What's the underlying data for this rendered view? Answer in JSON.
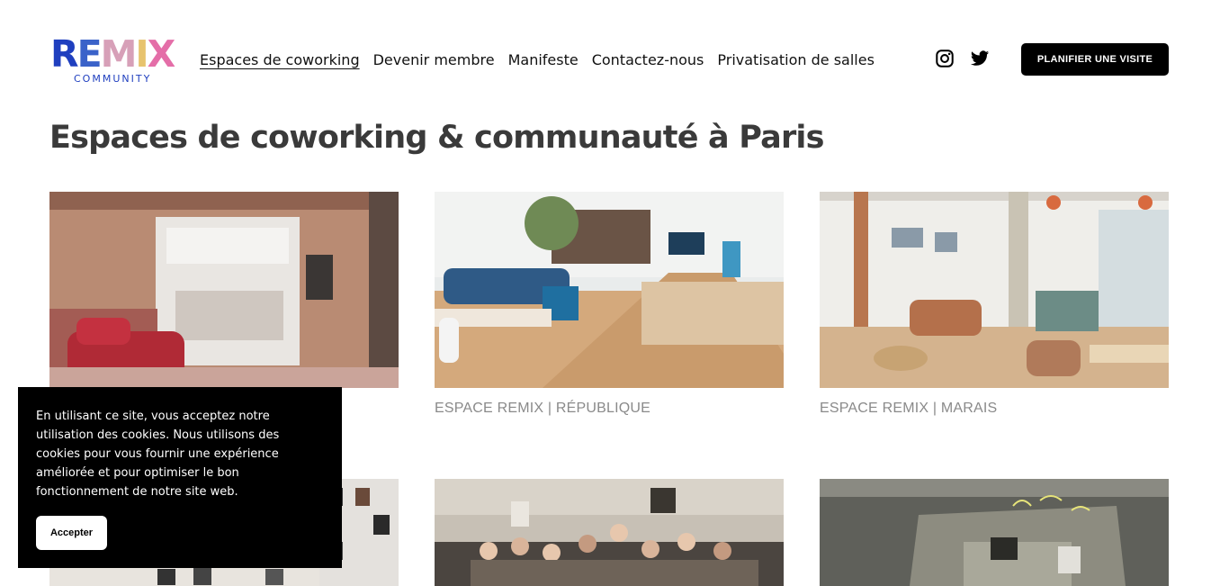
{
  "logo": {
    "main_letters": [
      "R",
      "E",
      "M",
      "I",
      "X"
    ],
    "sub": "COMMUNITY"
  },
  "nav": {
    "items": [
      {
        "label": "Espaces de coworking",
        "active": true
      },
      {
        "label": "Devenir membre"
      },
      {
        "label": "Manifeste"
      },
      {
        "label": "Contactez-nous"
      },
      {
        "label": "Privatisation de salles"
      }
    ]
  },
  "social": {
    "icons": [
      "instagram-icon",
      "twitter-icon"
    ]
  },
  "cta": {
    "label": "PLANIFIER UNE VISITE"
  },
  "page": {
    "title": "Espaces de coworking & communauté à Paris"
  },
  "cards": [
    {
      "caption": ""
    },
    {
      "caption": "ESPACE REMIX | RÉPUBLIQUE"
    },
    {
      "caption": "ESPACE REMIX | MARAIS"
    },
    {
      "caption": ""
    },
    {
      "caption": ""
    },
    {
      "caption": ""
    }
  ],
  "cookie": {
    "text": "En utilisant ce site, vous acceptez notre utilisation des cookies. Nous utilisons des cookies pour vous fournir une expérience améliorée et pour optimiser le bon fonctionnement de notre site web.",
    "accept_label": "Accepter"
  },
  "colors": {
    "brand_blue": "#1f3fbf",
    "brand_pink": "#e46ea8",
    "title_gray": "#3a3a3a",
    "caption_gray": "#8a8a8a"
  }
}
